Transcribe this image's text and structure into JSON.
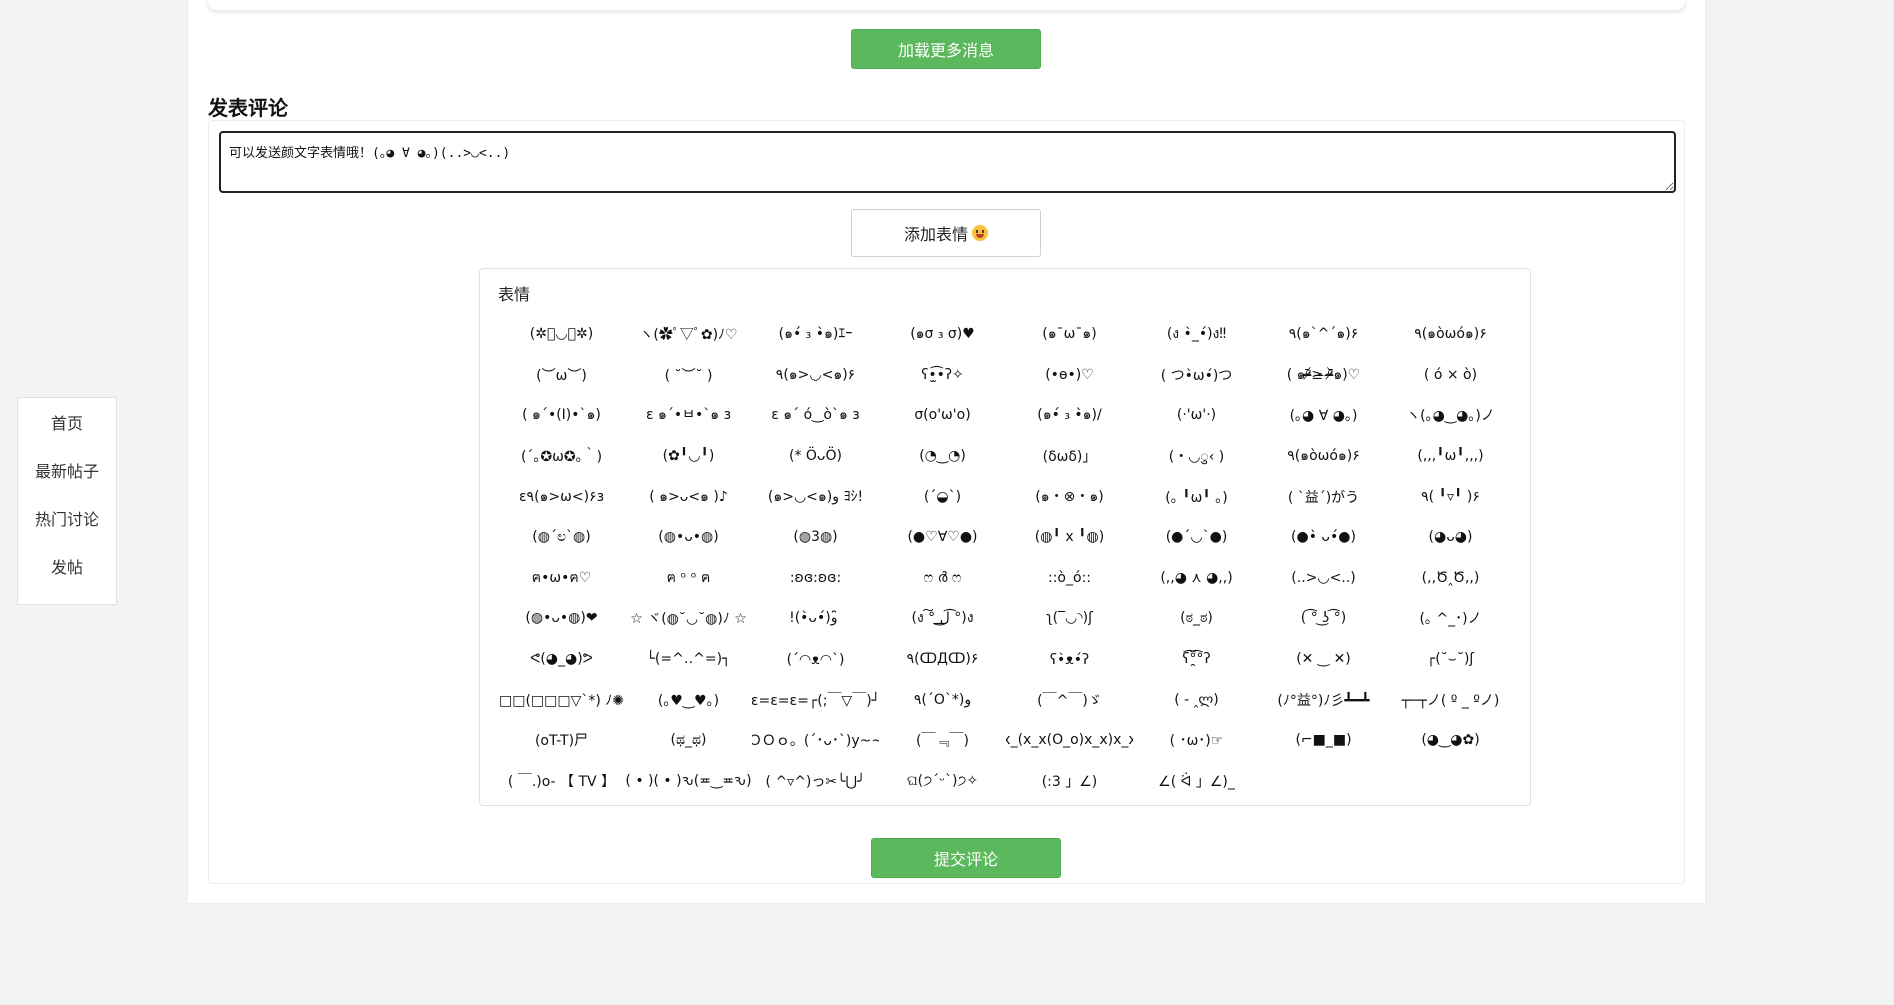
{
  "nav": {
    "items": [
      "首页",
      "最新帖子",
      "热门讨论",
      "发帖"
    ]
  },
  "load_more_label": "加载更多消息",
  "comment_section": {
    "title": "发表评论",
    "textarea_value": "可以发送颜文字表情哦！(｡◕ ∀ ◕｡)(..>◡<..)",
    "add_emoji_label": "添加表情",
    "add_emoji_icon": "smiley-icon",
    "submit_label": "提交评论"
  },
  "emoji_panel": {
    "title": "表情",
    "items": [
      "(✲ﾟ◡ﾟ✲)",
      "ヽ(✿ﾟ▽ﾟ✿)ﾉ♡",
      "(๑•́ ₃ •̀๑)ｴｰ",
      "(๑σ ₃ σ)♥",
      "(๑¯ω¯๑)",
      "(ง •̀_•́)ง‼",
      "٩(๑`^´๑)۶",
      "٩(๑òωó๑)۶",
      "(︶ω︶)",
      "( ˘︶˘ )",
      "٩(๑>◡<๑)۶",
      "ʕ•̫͡•ʔ✧",
      "(•ө•)♡",
      "( つ•̀ω•́)つ",
      "( ๑ᵒ̴̶̷᷄≥̶ ᵒ̴̶̷᷅๑)♡",
      "( ó × ò)",
      "( ๑´•(I)•`๑)",
      "ε ๑´•ㅂ•`๑ з",
      "ε ๑´ ó‿ò`๑ з",
      "σ(o'ω'o)",
      "(๑•́ ₃ •̀๑)/",
      "(·'ω'·)",
      "(｡◕ ∀ ◕｡)",
      "ヽ(｡◕‿◕｡)ノ",
      "(´｡✪ω✪｡｀)",
      "(✿╹◡╹)",
      "(* ÖᴗÖ)",
      "(◔‿◔)",
      "(δωδ)」",
      "(・◡ु‹ )",
      "٩(๑òωó๑)۶",
      "(,,,╹ω╹,,,)",
      "ε٩(๑>ω<)۶з",
      "( ๑>ᴗ<๑ )♪",
      "(๑>◡<๑)و ﾖｼ!",
      "(´◒`)",
      "(๑・⊗・๑)",
      "(｡ ╹ω╹ ｡)",
      "( `益´)がう",
      "٩( ╹▿╹ )۶",
      "(◍´ಲ`◍)",
      "(◍•ᴗ•◍)",
      "(◍3◍)",
      "(●♡∀♡●)",
      "(◍╹ x ╹◍)",
      "(●´◡`●)",
      "(●•̀ ᴗ•́●)",
      "(◕ᴗ◕)",
      "ฅ•ω•ฅ♡",
      "ฅ ᵒ ᵒ ฅ",
      ":ʚɞ:ʚɞ:",
      "ෆ ർ ෆ",
      "::ò_ó::",
      "(,,◕ ⋏ ◕,,)",
      "(..>◡<..)",
      "(,,Ծ‸Ծ,,)",
      "(◍•ᴗ•◍)❤",
      "☆ ヾ(◍˘◡˘◍)ﾉ ☆",
      "!(•̀ᴗ•́)و ̑̑",
      "(ง ͠° ͟ل͜ ͡°)ง",
      "ʅ(‾◡◝)ʃ",
      "(ಠ_ಠ)",
      "( ͡° ͜ʖ ͡°)",
      "(｡ ^_･)ノ",
      "ᕙ(◕_◕)ᕗ",
      "└(=^‥^=)┐",
      "(´◠ᴥ◠`)",
      "٩(ↀДↀ)۶",
      "ʕ•̀ᴥ•́ʔ",
      "ʕ͡°̯͡°ʔ",
      "(✕ ‿ ✕)",
      "┌(˘⌣˘)ʃ",
      "□□(□□□▽`*) ﾉ✺",
      "(｡♥‿♥｡)",
      "ε=ε=ε=┌(;￣▽￣)┘",
      "٩(´O`*)و",
      "(￣^￣)ゞ",
      "( - ‸ლ)",
      "(ﾉ°益°)ﾉ彡┻━┻",
      "┬─┬ノ( º _ ºノ)",
      "(oT-T)尸",
      "(ಥ_ಥ)",
      "ＯＯｏ。(´･ᴗ･`)y~~",
      "(￣﹃￣)",
      "(x(x_(x_x(O_o)x_x)x_x)x)",
      "( ･ω･)☞",
      "(⌐■_■)",
      "(◕‿◕✿)",
      "( ￣.)o- 【 TV 】",
      "( • )( • )ԅ(≖‿≖ԅ)",
      "( ^▿^)っ✂╰⋃╯",
      "ଘ(੭ˊᵕˋ)੭✧",
      "(:3 」∠)",
      "∠( ᐛ 」∠)_"
    ]
  },
  "colors": {
    "accent_green": "#5cb85c",
    "page_bg": "#f3f3f3"
  }
}
